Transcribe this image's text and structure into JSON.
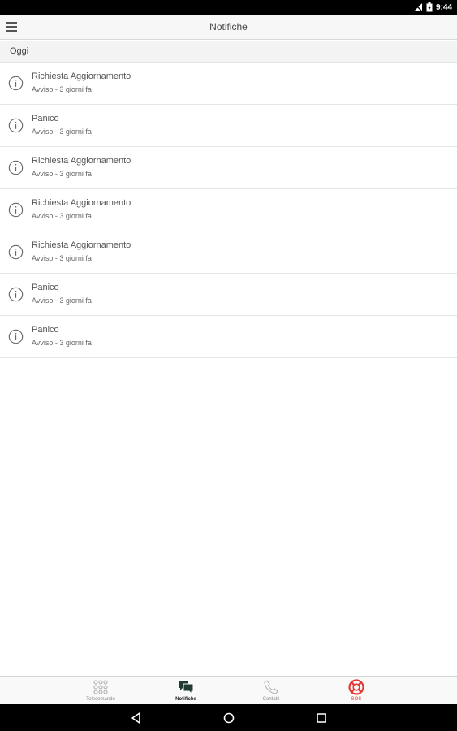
{
  "status_bar": {
    "time": "9:44"
  },
  "app_bar": {
    "title": "Notifiche"
  },
  "section": {
    "label": "Oggi"
  },
  "notifications": [
    {
      "title": "Richiesta Aggiornamento",
      "subtitle": "Avviso - 3 giorni fa"
    },
    {
      "title": "Panico",
      "subtitle": "Avviso - 3 giorni fa"
    },
    {
      "title": "Richiesta Aggiornamento",
      "subtitle": "Avviso - 3 giorni fa"
    },
    {
      "title": "Richiesta Aggiornamento",
      "subtitle": "Avviso - 3 giorni fa"
    },
    {
      "title": "Richiesta Aggiornamento",
      "subtitle": "Avviso - 3 giorni fa"
    },
    {
      "title": "Panico",
      "subtitle": "Avviso - 3 giorni fa"
    },
    {
      "title": "Panico",
      "subtitle": "Avviso - 3 giorni fa"
    }
  ],
  "tabs": [
    {
      "label": "Telecomando",
      "icon": "grid-icon"
    },
    {
      "label": "Notifiche",
      "icon": "chat-bubbles-icon"
    },
    {
      "label": "Contatti",
      "icon": "phone-icon"
    },
    {
      "label": "SOS",
      "icon": "lifebuoy-icon"
    }
  ],
  "colors": {
    "sos": "#e53935",
    "active_tab_icon": "#1f3b34",
    "status_bar": "#000000"
  }
}
